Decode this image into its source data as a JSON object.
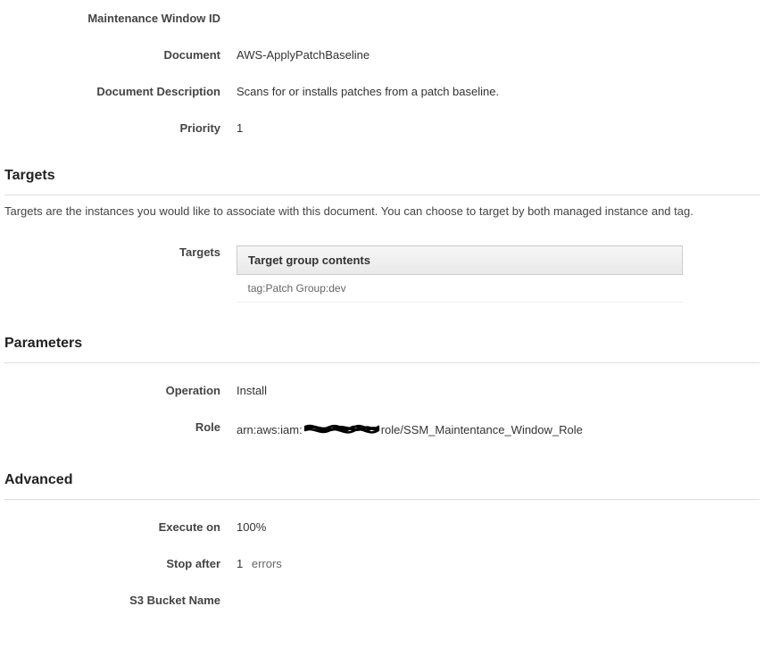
{
  "top_fields": {
    "mw_id_label": "Maintenance Window ID",
    "mw_id_value": "",
    "document_label": "Document",
    "document_value": "AWS-ApplyPatchBaseline",
    "doc_desc_label": "Document Description",
    "doc_desc_value": "Scans for or installs patches from a patch baseline.",
    "priority_label": "Priority",
    "priority_value": "1"
  },
  "targets": {
    "heading": "Targets",
    "description": "Targets are the instances you would like to associate with this document. You can choose to target by both managed instance and tag.",
    "field_label": "Targets",
    "table_header": "Target group contents",
    "table_row": "tag:Patch Group:dev"
  },
  "parameters": {
    "heading": "Parameters",
    "operation_label": "Operation",
    "operation_value": "Install",
    "role_label": "Role",
    "role_prefix": "arn:aws:iam:",
    "role_suffix": "role/SSM_Maintentance_Window_Role"
  },
  "advanced": {
    "heading": "Advanced",
    "execute_on_label": "Execute on",
    "execute_on_value": "100%",
    "stop_after_label": "Stop after",
    "stop_after_value": "1",
    "stop_after_suffix": "errors",
    "s3_bucket_label": "S3 Bucket Name",
    "s3_bucket_value": ""
  }
}
